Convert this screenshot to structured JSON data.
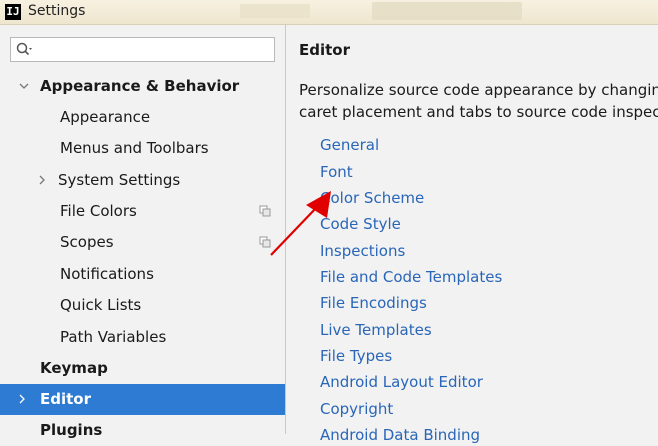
{
  "window": {
    "title": "Settings",
    "app_icon": "IJ"
  },
  "sidebar": {
    "search": {
      "value": "",
      "placeholder": ""
    },
    "items": [
      {
        "label": "Appearance & Behavior",
        "expanded": true
      },
      {
        "label": "Appearance"
      },
      {
        "label": "Menus and Toolbars"
      },
      {
        "label": "System Settings"
      },
      {
        "label": "File Colors"
      },
      {
        "label": "Scopes"
      },
      {
        "label": "Notifications"
      },
      {
        "label": "Quick Lists"
      },
      {
        "label": "Path Variables"
      },
      {
        "label": "Keymap"
      },
      {
        "label": "Editor",
        "selected": true
      },
      {
        "label": "Plugins"
      }
    ]
  },
  "editor_panel": {
    "heading": "Editor",
    "description_line1": "Personalize source code appearance by changing",
    "description_line2": "caret placement and tabs to source code inspecti",
    "links": [
      "General",
      "Font",
      "Color Scheme",
      "Code Style",
      "Inspections",
      "File and Code Templates",
      "File Encodings",
      "Live Templates",
      "File Types",
      "Android Layout Editor",
      "Copyright",
      "Android Data Binding"
    ]
  },
  "colors": {
    "selection": "#2e7bd3",
    "link": "#2966b8",
    "annotation_arrow": "#e00000"
  }
}
